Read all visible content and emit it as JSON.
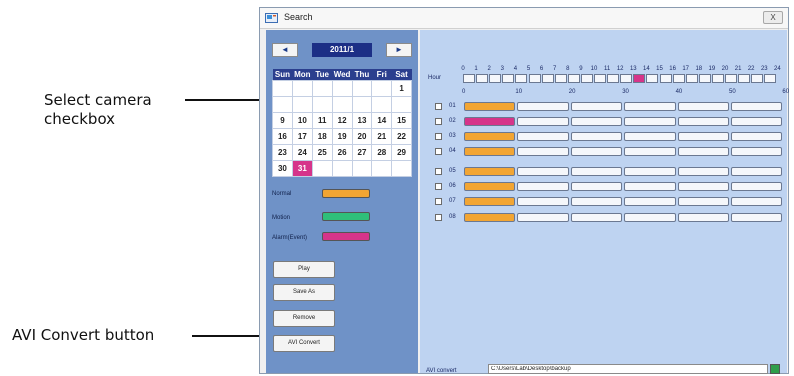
{
  "callouts": {
    "select_camera_line1": "Select camera",
    "select_camera_line2": "checkbox",
    "avi_convert": "AVI Convert button"
  },
  "window": {
    "title": "Search",
    "close_label": "X",
    "icon": "search-window-icon"
  },
  "calendar": {
    "prev_label": "◄",
    "next_label": "►",
    "month": "2011/1",
    "weekdays": [
      "Sun",
      "Mon",
      "Tue",
      "Wed",
      "Thu",
      "Fri",
      "Sat"
    ],
    "rows": [
      [
        "",
        "",
        "",
        "",
        "",
        "",
        "1"
      ],
      [
        "",
        "",
        "",
        "",
        "",
        "",
        ""
      ],
      [
        "9",
        "10",
        "11",
        "12",
        "13",
        "14",
        "15"
      ],
      [
        "16",
        "17",
        "18",
        "19",
        "20",
        "21",
        "22"
      ],
      [
        "23",
        "24",
        "25",
        "26",
        "27",
        "28",
        "29"
      ],
      [
        "30",
        "31",
        "",
        "",
        "",
        "",
        ""
      ]
    ],
    "selected_day": "31"
  },
  "legend": {
    "normal_label": "Normal",
    "motion_label": "Motion",
    "alarm_label": "Alarm(Event)",
    "normal_color": "#f2a533",
    "motion_color": "#2fbf7a",
    "alarm_color": "#d6348a"
  },
  "actions": {
    "play": "Play",
    "save_as": "Save As",
    "remove": "Remove",
    "avi_convert": "AVI Convert"
  },
  "timeline": {
    "hour_label": "Hour",
    "hours": [
      "0",
      "1",
      "2",
      "3",
      "4",
      "5",
      "6",
      "7",
      "8",
      "9",
      "10",
      "11",
      "12",
      "13",
      "14",
      "15",
      "16",
      "17",
      "18",
      "19",
      "20",
      "21",
      "22",
      "23",
      "24"
    ],
    "active_hour": 14,
    "minute_scale": [
      "0",
      "10",
      "20",
      "30",
      "40",
      "50",
      "60"
    ],
    "cameras": [
      {
        "label": "01",
        "first_segment": "normal"
      },
      {
        "label": "02",
        "first_segment": "alarm"
      },
      {
        "label": "03",
        "first_segment": "normal"
      },
      {
        "label": "04",
        "first_segment": "normal"
      },
      {
        "label": "05",
        "first_segment": "normal"
      },
      {
        "label": "06",
        "first_segment": "normal"
      },
      {
        "label": "07",
        "first_segment": "normal"
      },
      {
        "label": "08",
        "first_segment": "normal"
      }
    ]
  },
  "avi": {
    "label": "AVI convert",
    "path": "C:\\Users\\Lab\\Desktop\\backup",
    "browse_icon": "folder-icon"
  }
}
